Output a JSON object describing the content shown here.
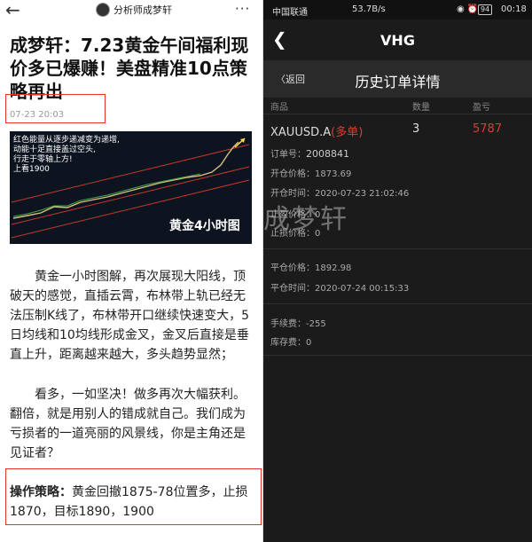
{
  "left": {
    "top_bar": {
      "back_icon": "back-arrow-icon",
      "author": "分析师成梦轩",
      "more_icon": "more-dots-icon"
    },
    "title": "成梦轩：7.23黄金午间福利现价多已爆赚！美盘精准10点策略再出",
    "date": "07-23 20:03",
    "chart_image": {
      "note": "红色能量从逐步递减变为递增,\n动能十足直接盖过空头,\n行走于零轴上方!\n上看1900",
      "caption": "黄金4小时图"
    },
    "paragraphs": {
      "p1": "黄金一小时图解，再次展现大阳线，顶破天的感觉，直插云霄，布林带上轨已经无法压制K线了，布林带开口继续快速变大，5日均线和10均线形成金叉，金叉后直接是垂直上升，距离越来越大，多头趋势显然；",
      "p2": "看多，一如坚决！做多再次大幅获利。翻倍，就是用别人的错成就自己。我们成为亏损者的一道亮丽的风景线，你是主角还是见证者？",
      "p3_label": "操作策略：",
      "p3_text": "黄金回撤1875-78位置多，止损1870，目标1890，1900"
    },
    "highlight_color": "#e6322b"
  },
  "right": {
    "status_bar": {
      "carrier": "中国联通",
      "speed": "53.7B/s",
      "icons": "◉ ⏰",
      "battery": "94",
      "time": "00:18"
    },
    "app_bar": {
      "back_icon": "chevron-left-icon",
      "title": "VHG"
    },
    "sub_bar": {
      "back_label": "〈返回",
      "title": "历史订单详情"
    },
    "columns": {
      "product": "商品",
      "qty": "数量",
      "profit": "盈亏"
    },
    "order": {
      "symbol": "XAUUSD.A",
      "direction": "(多单)",
      "qty": "3",
      "profit": "5787"
    },
    "details": {
      "order_no_label": "订单号：",
      "order_no": "2008841",
      "open_price_label": "开仓价格：",
      "open_price": "1873.69",
      "open_time_label": "开仓时间：",
      "open_time": "2020-07-23 21:02:46",
      "tp_label": "止盈价格：",
      "tp": "0",
      "sl_label": "止损价格：",
      "sl": "0",
      "close_price_label": "平仓价格：",
      "close_price": "1892.98",
      "close_time_label": "平仓时间：",
      "close_time": "2020-07-24 00:15:33",
      "fee_label": "手续费：",
      "fee": "-255",
      "storage_label": "库存费：",
      "storage": "0"
    },
    "watermark": "成梦轩",
    "colors": {
      "profit": "#e23a2f",
      "text": "#dddddd"
    }
  }
}
